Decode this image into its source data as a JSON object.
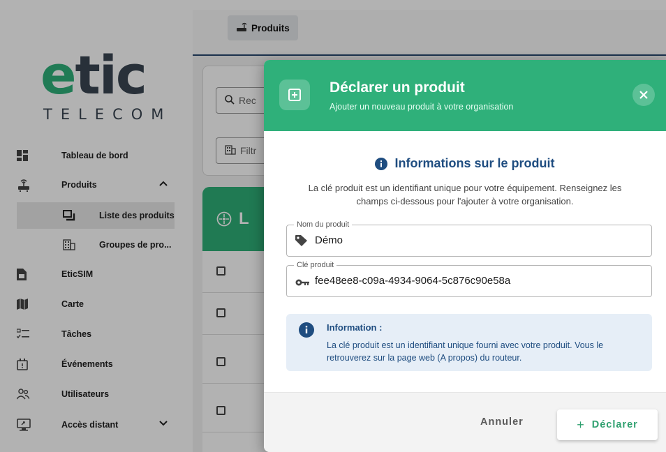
{
  "brand": {
    "logo_word": "etic",
    "logo_sub": "TELECOM",
    "accent": "#2fb07a",
    "navy": "#1f4d80"
  },
  "topbar": {
    "breadcrumb": "Produits"
  },
  "sidebar": {
    "items": [
      {
        "label": "Tableau de bord",
        "icon": "dashboard-icon"
      },
      {
        "label": "Produits",
        "icon": "router-icon",
        "expanded": true
      },
      {
        "label": "EticSIM",
        "icon": "sim-card-icon"
      },
      {
        "label": "Carte",
        "icon": "map-icon"
      },
      {
        "label": "Tâches",
        "icon": "tasks-icon"
      },
      {
        "label": "Événements",
        "icon": "calendar-alert-icon"
      },
      {
        "label": "Utilisateurs",
        "icon": "users-icon"
      },
      {
        "label": "Accès distant",
        "icon": "remote-access-icon",
        "collapsed": true
      }
    ],
    "sub_items": [
      {
        "label": "Liste des produits",
        "icon": "copy-list-icon",
        "active": true
      },
      {
        "label": "Groupes de pro...",
        "icon": "building-icon"
      }
    ]
  },
  "background": {
    "search_placeholder": "Rec",
    "filter_label": "Filtr",
    "list_title": "L"
  },
  "dialog": {
    "title": "Déclarer un produit",
    "subtitle": "Ajouter un nouveau produit à votre organisation",
    "section_title": "Informations sur le produit",
    "section_desc": "La clé produit est un identifiant unique pour votre équipement. Renseignez les champs ci-dessous pour l'ajouter à votre organisation.",
    "fields": {
      "name": {
        "label": "Nom du produit",
        "value": "Démo"
      },
      "key": {
        "label": "Clé produit",
        "value": "fee48ee8-c09a-4934-9064-5c876c90e58a"
      }
    },
    "alert": {
      "title": "Information :",
      "text": "La clé produit est un identifiant unique fourni avec votre produit. Vous le retrouverez sur la page web (A propos) du routeur."
    },
    "buttons": {
      "cancel": "Annuler",
      "declare": "Déclarer"
    }
  }
}
